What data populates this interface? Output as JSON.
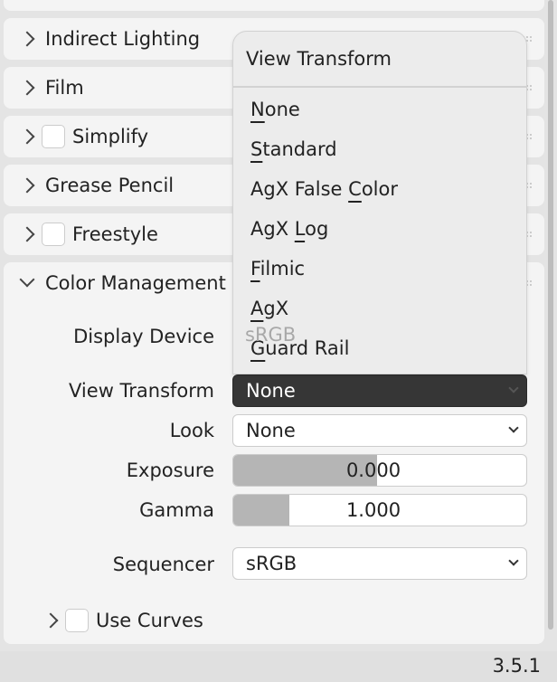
{
  "panels": [
    {
      "label": "Indirect Lighting",
      "checkbox": false
    },
    {
      "label": "Film",
      "checkbox": false
    },
    {
      "label": "Simplify",
      "checkbox": true
    },
    {
      "label": "Grease Pencil",
      "checkbox": false
    },
    {
      "label": "Freestyle",
      "checkbox": true
    }
  ],
  "color_management": {
    "label": "Color Management",
    "display_device": {
      "label": "Display Device",
      "value": "sRGB"
    },
    "view_transform": {
      "label": "View Transform",
      "value": "None"
    },
    "look": {
      "label": "Look",
      "value": "None"
    },
    "exposure": {
      "label": "Exposure",
      "value": "0.000",
      "fill_fraction": 0.49
    },
    "gamma": {
      "label": "Gamma",
      "value": "1.000",
      "fill_fraction": 0.19
    },
    "sequencer": {
      "label": "Sequencer",
      "value": "sRGB"
    },
    "use_curves": {
      "label": "Use Curves",
      "checked": false
    }
  },
  "menu": {
    "title": "View Transform",
    "items": [
      {
        "pre": "",
        "key": "N",
        "post": "one"
      },
      {
        "pre": "",
        "key": "S",
        "post": "tandard"
      },
      {
        "pre": "AgX False ",
        "key": "C",
        "post": "olor"
      },
      {
        "pre": "AgX ",
        "key": "L",
        "post": "og"
      },
      {
        "pre": "",
        "key": "F",
        "post": "ilmic"
      },
      {
        "pre": "",
        "key": "A",
        "post": "gX"
      },
      {
        "pre": "",
        "key": "G",
        "post": "uard Rail"
      }
    ]
  },
  "status": {
    "version": "3.5.1"
  }
}
